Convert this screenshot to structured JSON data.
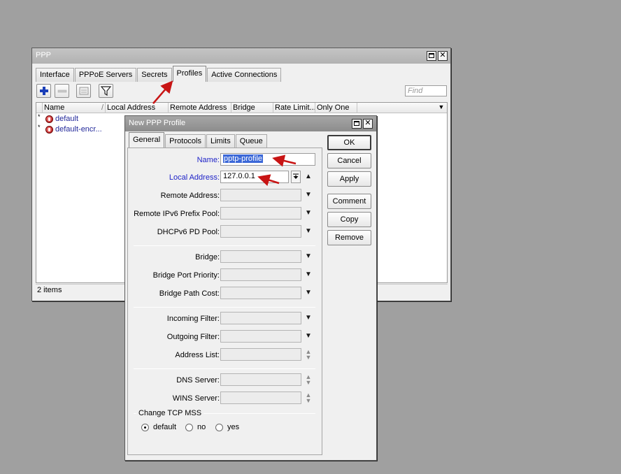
{
  "ppp_window": {
    "title": "PPP",
    "tabs": [
      "Interface",
      "PPPoE Servers",
      "Secrets",
      "Profiles",
      "Active Connections"
    ],
    "active_tab": "Profiles",
    "find_placeholder": "Find",
    "columns": [
      "Name",
      "/",
      "Local Address",
      "Remote Address",
      "Bridge",
      "Rate Limit...",
      "Only One"
    ],
    "rows": [
      {
        "mark": "*",
        "name": "default"
      },
      {
        "mark": "*",
        "name": "default-encr..."
      }
    ],
    "status": "2 items"
  },
  "dialog": {
    "title": "New PPP Profile",
    "tabs": [
      "General",
      "Protocols",
      "Limits",
      "Queue"
    ],
    "active_tab": "General",
    "fields": {
      "name_label": "Name:",
      "name_value": "pptp-profile",
      "local_address_label": "Local Address:",
      "local_address_value": "127.0.0.1",
      "remote_address_label": "Remote Address:",
      "remote_ipv6_label": "Remote IPv6 Prefix Pool:",
      "dhcpv6_label": "DHCPv6 PD Pool:",
      "bridge_label": "Bridge:",
      "bridge_port_priority_label": "Bridge Port Priority:",
      "bridge_path_cost_label": "Bridge Path Cost:",
      "incoming_filter_label": "Incoming Filter:",
      "outgoing_filter_label": "Outgoing Filter:",
      "address_list_label": "Address List:",
      "dns_server_label": "DNS Server:",
      "wins_server_label": "WINS Server:"
    },
    "tcp_mss": {
      "group_label": "Change TCP MSS",
      "options": [
        "default",
        "no",
        "yes"
      ],
      "selected": "default"
    },
    "buttons": [
      "OK",
      "Cancel",
      "Apply",
      "Comment",
      "Copy",
      "Remove"
    ]
  },
  "colors": {
    "desktop": "#a0a0a0",
    "annotation_arrow": "#c81414",
    "label_blue": "#1e22c8",
    "add_icon": "#1b3fb8"
  }
}
